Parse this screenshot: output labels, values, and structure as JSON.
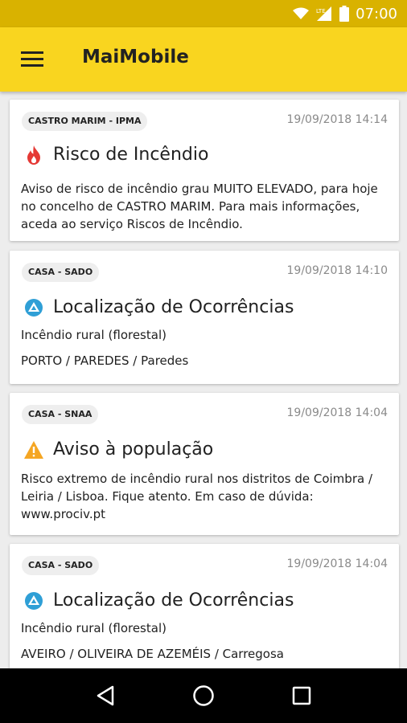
{
  "status_bar": {
    "time": "07:00",
    "network_label": "LTE"
  },
  "app_bar": {
    "title": "MaiMobile"
  },
  "cards": [
    {
      "badge": "CASTRO MARIM - IPMA",
      "date": "19/09/2018 14:14",
      "icon": "fire-icon",
      "title": "Risco de Incêndio",
      "lines": [
        "Aviso de risco de incêndio grau MUITO ELEVADO, para hoje no concelho de CASTRO MARIM. Para mais informações, aceda ao serviço Riscos de Incêndio."
      ]
    },
    {
      "badge": "CASA - SADO",
      "date": "19/09/2018 14:10",
      "icon": "civil-protection-icon",
      "title": "Localização de Ocorrências",
      "lines": [
        "Incêndio rural (florestal)",
        "PORTO / PAREDES / Paredes"
      ]
    },
    {
      "badge": "CASA - SNAA",
      "date": "19/09/2018 14:04",
      "icon": "warning-icon",
      "title": "Aviso à população",
      "lines": [
        "Risco extremo de incêndio rural nos distritos de Coimbra / Leiria / Lisboa. Fique atento. Em caso de dúvida: www.prociv.pt"
      ]
    },
    {
      "badge": "CASA - SADO",
      "date": "19/09/2018 14:04",
      "icon": "civil-protection-icon",
      "title": "Localização de Ocorrências",
      "lines": [
        "Incêndio rural (florestal)",
        "AVEIRO / OLIVEIRA DE AZEMÉIS / Carregosa"
      ]
    }
  ],
  "colors": {
    "status_bar": "#d9b200",
    "app_bar": "#f9d51f",
    "fire": "#e53935",
    "civil_protection": "#2f9fd6",
    "warning": "#f5a623"
  }
}
